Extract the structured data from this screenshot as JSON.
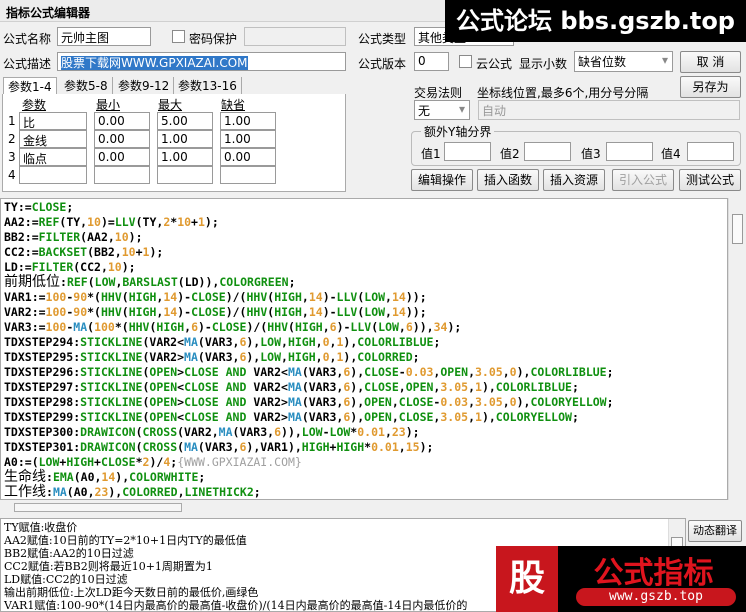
{
  "window": {
    "title": "指标公式编辑器"
  },
  "form": {
    "name_label": "公式名称",
    "name_value": "元帅主图",
    "password_label": "密码保护",
    "password_value": "",
    "type_label": "公式类型",
    "type_value": "其他类型",
    "desc_label": "公式描述",
    "desc_value": "股票下载网WWW.GPXIAZAI.COM",
    "version_label": "公式版本",
    "version_value": "0",
    "cloud_label": "云公式",
    "decimal_label": "显示小数",
    "decimal_value": "缺省位数"
  },
  "buttons": {
    "cancel": "取 消",
    "save_as": "另存为",
    "edit_ops": "编辑操作",
    "insert_func": "插入函数",
    "insert_res": "插入资源",
    "import_formula": "引入公式",
    "test_formula": "测试公式",
    "dynamic_translate": "动态翻译"
  },
  "tabs": [
    "参数1-4",
    "参数5-8",
    "参数9-12",
    "参数13-16"
  ],
  "params": {
    "headers": [
      "参数",
      "最小",
      "最大",
      "缺省"
    ],
    "rows": [
      {
        "idx": "1",
        "name": "比",
        "min": "0.00",
        "max": "5.00",
        "def": "1.00"
      },
      {
        "idx": "2",
        "name": "金线",
        "min": "0.00",
        "max": "1.00",
        "def": "1.00"
      },
      {
        "idx": "3",
        "name": "临点",
        "min": "0.00",
        "max": "1.00",
        "def": "0.00"
      },
      {
        "idx": "4",
        "name": "",
        "min": "",
        "max": "",
        "def": ""
      }
    ]
  },
  "trade": {
    "rule_label": "交易法则",
    "rule_value": "无",
    "axis_label": "坐标线位置,最多6个,用分号分隔",
    "axis_value": "自动"
  },
  "yaxis": {
    "legend": "额外Y轴分界",
    "labels": [
      "值1",
      "值2",
      "值3",
      "值4"
    ]
  },
  "code_lines": [
    "TY:=CLOSE;",
    "AA2:=REF(TY,10)=LLV(TY,2*10+1);",
    "BB2:=FILTER(AA2,10);",
    "CC2:=BACKSET(BB2,10+1);",
    "LD:=FILTER(CC2,10);",
    "前期低位:REF(LOW,BARSLAST(LD)),COLORGREEN;",
    "VAR1:=100-90*(HHV(HIGH,14)-CLOSE)/(HHV(HIGH,14)-LLV(LOW,14));",
    "VAR2:=100-90*(HHV(HIGH,14)-CLOSE)/(HHV(HIGH,14)-LLV(LOW,14));",
    "VAR3:=100-MA(100*(HHV(HIGH,6)-CLOSE)/(HHV(HIGH,6)-LLV(LOW,6)),34);",
    "TDXSTEP294:STICKLINE(VAR2<MA(VAR3,6),LOW,HIGH,0,1),COLORLIBLUE;",
    "TDXSTEP295:STICKLINE(VAR2>MA(VAR3,6),LOW,HIGH,0,1),COLORRED;",
    "TDXSTEP296:STICKLINE(OPEN>CLOSE AND VAR2<MA(VAR3,6),CLOSE-0.03,OPEN,3.05,0),COLORLIBLUE;",
    "TDXSTEP297:STICKLINE(OPEN<CLOSE AND VAR2<MA(VAR3,6),CLOSE,OPEN,3.05,1),COLORLIBLUE;",
    "TDXSTEP298:STICKLINE(OPEN>CLOSE AND VAR2>MA(VAR3,6),OPEN,CLOSE-0.03,3.05,0),COLORYELLOW;",
    "TDXSTEP299:STICKLINE(OPEN<CLOSE AND VAR2>MA(VAR3,6),OPEN,CLOSE,3.05,1),COLORYELLOW;",
    "TDXSTEP300:DRAWICON(CROSS(VAR2,MA(VAR3,6)),LOW-LOW*0.01,23);",
    "TDXSTEP301:DRAWICON(CROSS(MA(VAR3,6),VAR1),HIGH+HIGH*0.01,15);",
    "A0:=(LOW+HIGH+CLOSE*2)/4;{WWW.GPXIAZAI.COM}",
    "生命线:EMA(A0,14),COLORWHITE;",
    "工作线:MA(A0,23),COLORRED,LINETHICK2;"
  ],
  "translation_lines": [
    "TY赋值:收盘价",
    "AA2赋值:10日前的TY=2*10+1日内TY的最低值",
    "BB2赋值:AA2的10日过滤",
    "CC2赋值:若BB2则将最近10+1周期置为1",
    "LD赋值:CC2的10日过滤",
    "输出前期低位:上次LD距今天数日前的最低价,画绿色",
    "VAR1赋值:100-90*(14日内最高价的最高值-收盘价)/(14日内最高价的最高值-14日内最低价的"
  ],
  "watermarks": {
    "top": "公式论坛 bbs.gszb.top",
    "bottom_logo": "股",
    "bottom_title": "公式指标",
    "bottom_url": "www.gszb.top"
  },
  "colors": {
    "keyword": "#109010",
    "number": "#e09a30",
    "ma": "#2a8ec0",
    "comment": "#a0a0a0",
    "selection": "#3078c8",
    "watermark_red": "#c8161d"
  }
}
